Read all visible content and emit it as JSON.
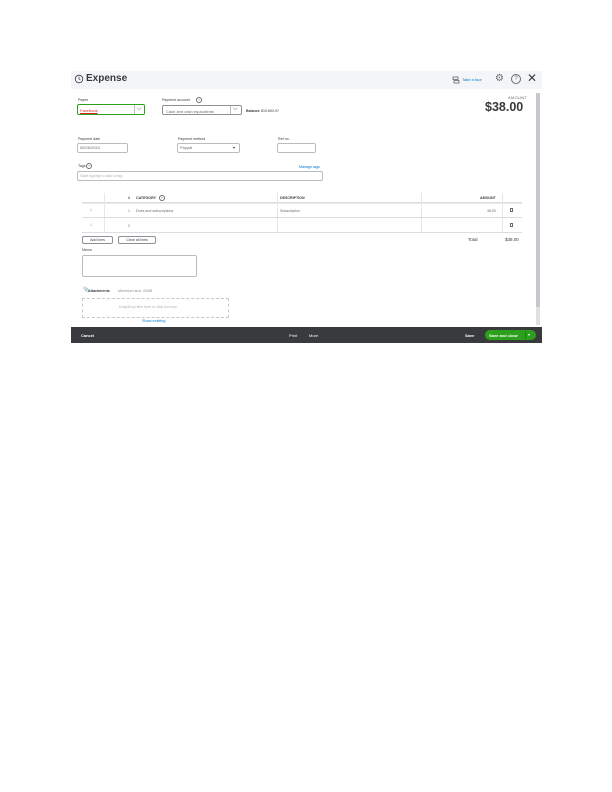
{
  "header": {
    "title": "Expense",
    "tour_label": "Take a tour",
    "help_symbol": "?",
    "close_symbol": "✕",
    "gear_symbol": "⚙"
  },
  "payee": {
    "label": "Payee",
    "value": "Facebook"
  },
  "payment_account": {
    "label": "Payment account",
    "value": "Cash and cash equivalents",
    "balance_label": "Balance",
    "balance_value": "$19,693.97"
  },
  "amount": {
    "label": "AMOUNT",
    "value": "$38.00"
  },
  "payment_date": {
    "label": "Payment date",
    "value": "05/26/2024"
  },
  "payment_method": {
    "label": "Payment method",
    "value": "Paypal"
  },
  "ref_no": {
    "label": "Ref no.",
    "value": ""
  },
  "tags": {
    "label": "Tags",
    "placeholder": "Start typing to add a tag",
    "manage_link": "Manage tags"
  },
  "table": {
    "headers": {
      "num": "#",
      "category": "CATEGORY",
      "description": "DESCRIPTION",
      "amount": "AMOUNT"
    },
    "rows": [
      {
        "num": "1",
        "category": "Dues and subscriptions",
        "description": "Subscription",
        "amount": "38.00"
      },
      {
        "num": "2",
        "category": "",
        "description": "",
        "amount": ""
      }
    ],
    "add_lines": "Add lines",
    "clear_all_lines": "Clear all lines",
    "total_label": "Total",
    "total_value": "$38.00"
  },
  "memo": {
    "label": "Memo"
  },
  "attachments": {
    "label": "Attachments",
    "max_size": "Maximum size: 20MB",
    "drop_text": "Drag/Drop files here or click the icon",
    "show_existing": "Show existing"
  },
  "footer": {
    "cancel": "Cancel",
    "print": "Print",
    "more": "More",
    "save": "Save",
    "save_and_close": "Save and close"
  },
  "colors": {
    "accent": "#2ca01c",
    "link": "#0077c5",
    "footer": "#393a3d"
  }
}
